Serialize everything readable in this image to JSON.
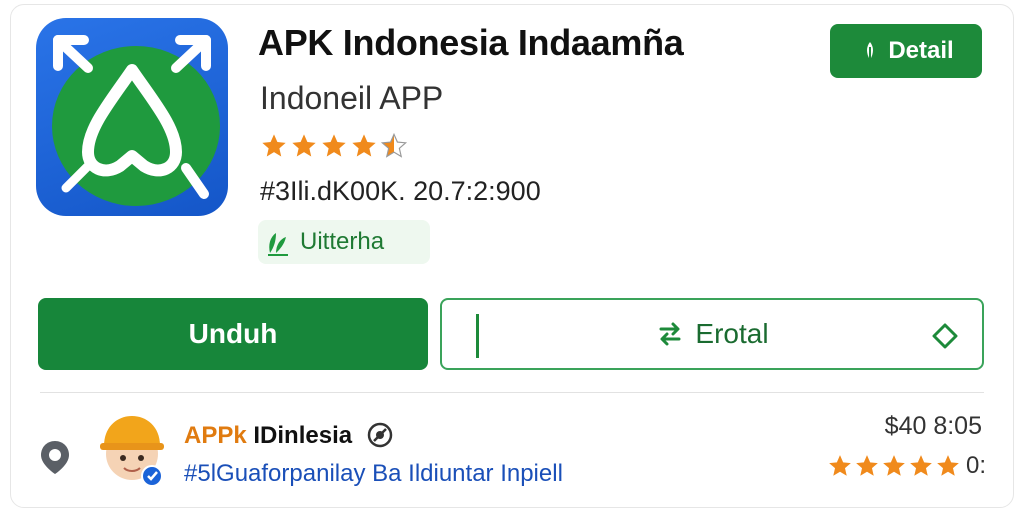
{
  "app": {
    "title": "APK Indonesia Indaamña",
    "subtitle": "Indoneil APP",
    "rating_stars": 4.5,
    "meta": "#3Ili.dK00K. 20.7:2:900",
    "badge_label": "Uitterha"
  },
  "header": {
    "detail_label": "Detail"
  },
  "actions": {
    "download_label": "Unduh",
    "secondary_label": "Erotal"
  },
  "developer": {
    "name_orange": "APPk ",
    "name_black": "IDinlesia",
    "tagline": "#5lGuaforpanilay Ba Ildiuntar Inpiell",
    "price": "$40 8:05",
    "rating_stars": 5,
    "rating_label": "0:"
  },
  "colors": {
    "accent_green": "#1d8a3a",
    "star_orange": "#f08a1c",
    "icon_blue": "#1b63d8",
    "link_blue": "#1a4fb8"
  },
  "icons": {
    "app": "app-logo-icon",
    "detail": "leaf-icon",
    "badge": "verified-leaf-icon",
    "secondary": "swap-icon",
    "secondary_right": "diamond-icon",
    "location": "location-pin-icon",
    "verified": "verified-icon"
  }
}
